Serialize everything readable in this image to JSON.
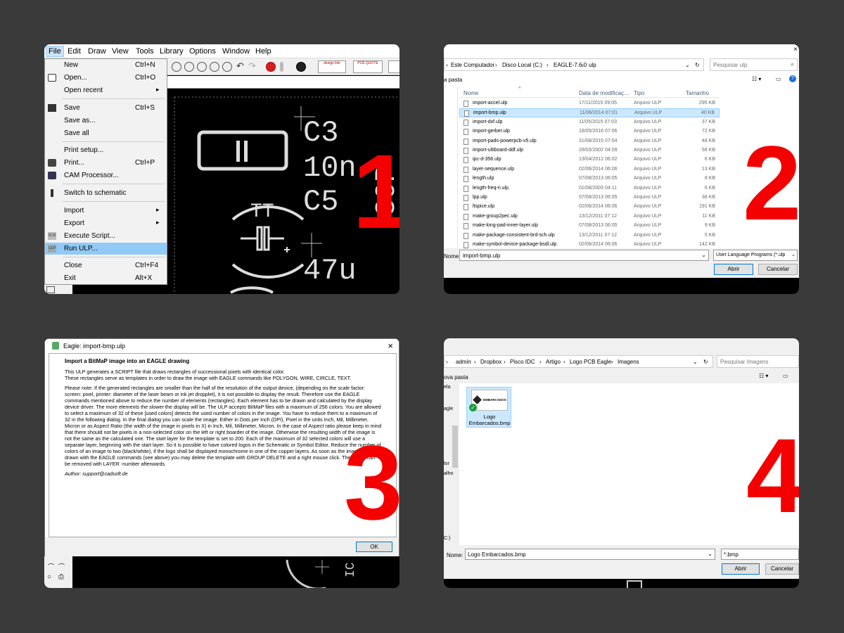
{
  "step_numbers": [
    "1",
    "2",
    "3",
    "4"
  ],
  "panel1": {
    "menubar": [
      "File",
      "Edit",
      "Draw",
      "View",
      "Tools",
      "Library",
      "Options",
      "Window",
      "Help"
    ],
    "file_menu": [
      {
        "label": "New",
        "shortcut": "Ctrl+N"
      },
      {
        "label": "Open...",
        "shortcut": "Ctrl+O"
      },
      {
        "label": "Open recent",
        "shortcut": ""
      },
      {
        "label": "Save",
        "shortcut": "Ctrl+S"
      },
      {
        "label": "Save as...",
        "shortcut": ""
      },
      {
        "label": "Save all",
        "shortcut": ""
      },
      {
        "label": "Print setup...",
        "shortcut": ""
      },
      {
        "label": "Print...",
        "shortcut": "Ctrl+P"
      },
      {
        "label": "CAM Processor...",
        "shortcut": ""
      },
      {
        "label": "Switch to schematic",
        "shortcut": ""
      },
      {
        "label": "Import",
        "shortcut": ""
      },
      {
        "label": "Export",
        "shortcut": ""
      },
      {
        "label": "Execute Script...",
        "shortcut": ""
      },
      {
        "label": "Run ULP...",
        "shortcut": ""
      },
      {
        "label": "Close",
        "shortcut": "Ctrl+F4"
      },
      {
        "label": "Exit",
        "shortcut": "Alt+X"
      }
    ],
    "toolbar_buttons": [
      "design link",
      "PCB QUOTE"
    ],
    "canvas_labels": {
      "c3": "C3",
      "val10": "10n",
      "c5": "C5",
      "val47": "47u",
      "val30": "30P",
      "tt": "TT"
    }
  },
  "panel2": {
    "address": [
      "Este Computador",
      "Disco Local (C:)",
      "EAGLE-7.6.0",
      "ulp"
    ],
    "search_placeholder": "Pesquisar ulp",
    "folder_label": "a pasta",
    "columns": {
      "name": "Nome",
      "date": "Data de modificaç...",
      "type": "Tipo",
      "size": "Tamanho"
    },
    "files": [
      {
        "name": "import-accel.ulp",
        "date": "17/11/2015 09:05",
        "type": "Arquivo ULP",
        "size": "295 KB"
      },
      {
        "name": "import-bmp.ulp",
        "date": "11/08/2014 07:01",
        "type": "Arquivo ULP",
        "size": "40 KB"
      },
      {
        "name": "import-dxf.ulp",
        "date": "11/05/2015 07:03",
        "type": "Arquivo ULP",
        "size": "37 KB"
      },
      {
        "name": "import-gerber.ulp",
        "date": "18/05/2016 07:06",
        "type": "Arquivo ULP",
        "size": "72 KB"
      },
      {
        "name": "import-pads-powerpcb-v5.ulp",
        "date": "31/08/2015 07:04",
        "type": "Arquivo ULP",
        "size": "48 KB"
      },
      {
        "name": "import-ultiboard-ddf.ulp",
        "date": "28/03/2002 04:09",
        "type": "Arquivo ULP",
        "size": "58 KB"
      },
      {
        "name": "ipc-d-356.ulp",
        "date": "13/04/2012 06:02",
        "type": "Arquivo ULP",
        "size": "6 KB"
      },
      {
        "name": "layer-sequence.ulp",
        "date": "02/06/2014 06:06",
        "type": "Arquivo ULP",
        "size": "13 KB"
      },
      {
        "name": "length.ulp",
        "date": "07/08/2013 06:05",
        "type": "Arquivo ULP",
        "size": "8 KB"
      },
      {
        "name": "length-freq-ri.ulp",
        "date": "01/08/2003 04:11",
        "type": "Arquivo ULP",
        "size": "6 KB"
      },
      {
        "name": "lpp.ulp",
        "date": "07/08/2013 06:05",
        "type": "Arquivo ULP",
        "size": "38 KB"
      },
      {
        "name": "ltspice.ulp",
        "date": "02/06/2014 06:06",
        "type": "Arquivo ULP",
        "size": "191 KB"
      },
      {
        "name": "make-group2pec.ulp",
        "date": "13/12/2011 07:12",
        "type": "Arquivo ULP",
        "size": "11 KB"
      },
      {
        "name": "make-long-pad-inner-layer.ulp",
        "date": "07/08/2013 06:05",
        "type": "Arquivo ULP",
        "size": "9 KB"
      },
      {
        "name": "make-package-consistent-brd-sch.ulp",
        "date": "13/12/2011 07:12",
        "type": "Arquivo ULP",
        "size": "5 KB"
      },
      {
        "name": "make-symbol-device-package-bsdl.ulp",
        "date": "02/06/2014 06:06",
        "type": "Arquivo ULP",
        "size": "142 KB"
      }
    ],
    "name_label": "Nome:",
    "name_value": "import-bmp.ulp",
    "filter_value": "User Language Programs (*.ulp",
    "open_button": "Abrir",
    "cancel_button": "Cancelar"
  },
  "panel3": {
    "title": "Eagle: import-bmp.ulp",
    "heading": "Import a BitMaP image into an EAGLE drawing",
    "para1a": "This ULP generates a SCRIPT file that draws rectangles of successional pixels with identical color.",
    "para1b": "These rectangles serve as templates in order to draw the image with EAGLE commands like POLYGON, WIRE, CIRCLE, TEXT.",
    "para2": "Please note: If the generated rectangles are smaller than the half of the resolution of the output device, (depending on the scale factor: screen: pixel, printer: diameter of the laser beam or ink jet dropplet), it is not possible to display the result. Therefore use the EAGLE commands mentioned above to reduce the number of elements (rectangles). Each element has to be drawn and calculated by the display device driver. The more elements the slower the display will be. The ULP accepts BitMaP files with a maximum of 256 colors. You are allowed to select a maximum of 32 of these [used colors] detects the used number of colors in the image. You have to reduce them to a maximum of 32 in the following dialog. In the final dialog you can scale the image. Either in Dots per Inch (DPI), Pixel in the units Inch, Mil, Millimeter, Micron or as Aspect Ratio (the width of the image in pixels in X) in Inch, Mil, Millimeter, Micron. In the case of Aspect ratio please keep in mind that there should not be pixels in a non-selected color on the left or right boarder of the image. Otherwise the resulting width of the image is not the same as the calculated one. The start layer for the template is set to 200. Each of the maximum of 32 selected colors will use a separate layer, beginning with the start layer. So it is possible to have colored logos in the Schematic or Symbol Editor. Reduce the number of colors of an image to two (black/white), if the logo shall be displayed monochrome in one of the copper layers. As soon as the image (logo) is drawn with the EAGLE commands (see above) you may delete the template with GROUP DELETE and a right mouse click. The layers can be removed with LAYER -number afterwards.",
    "author": "Author: support@cadsoft.de",
    "ok_button": "OK"
  },
  "panel4": {
    "address": [
      "admin",
      "Dropbox",
      "Pisco IDC",
      "Artigo",
      "Logo PCB Eagle",
      "Imagens"
    ],
    "search_placeholder": "Pesquisar Imagens",
    "new_folder": "ova pasta",
    "left_labels": [
      "ela",
      "agle",
      "lor",
      "alho",
      "C:)"
    ],
    "tile_label": "Logo Embarcados.bmp",
    "thumb_text": "EMBARCADOS",
    "name_label": "Nome:",
    "name_value": "Logo Embarcados.bmp",
    "filter_value": "*.bmp",
    "open_button": "Abrir",
    "cancel_button": "Cancelar"
  }
}
